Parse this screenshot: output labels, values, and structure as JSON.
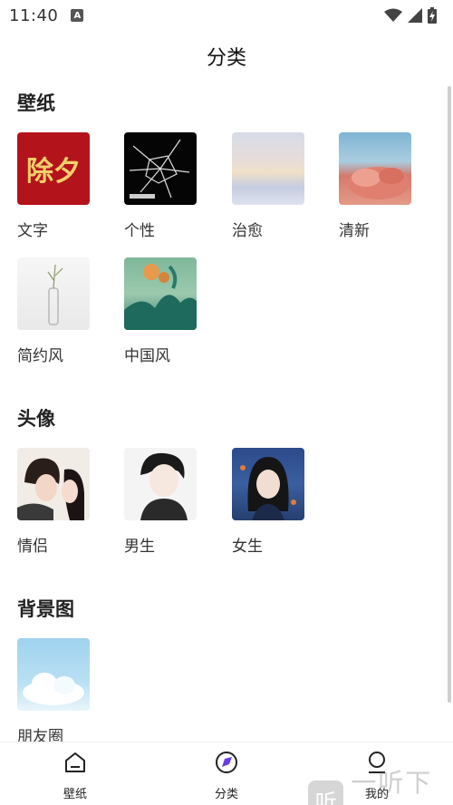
{
  "status": {
    "time": "11:40",
    "notif_badge": "A"
  },
  "page": {
    "title": "分类"
  },
  "sections": [
    {
      "title": "壁纸",
      "items": [
        {
          "label": "文字",
          "thumb_text": "除夕"
        },
        {
          "label": "个性"
        },
        {
          "label": "治愈"
        },
        {
          "label": "清新"
        },
        {
          "label": "简约风"
        },
        {
          "label": "中国风"
        }
      ]
    },
    {
      "title": "头像",
      "items": [
        {
          "label": "情侣"
        },
        {
          "label": "男生"
        },
        {
          "label": "女生"
        }
      ]
    },
    {
      "title": "背景图",
      "items": [
        {
          "label": "朋友圈"
        }
      ]
    }
  ],
  "nav": {
    "items": [
      {
        "label": "壁纸",
        "icon": "home-icon"
      },
      {
        "label": "分类",
        "icon": "category-icon",
        "active": true
      },
      {
        "label": "我的",
        "icon": "profile-icon"
      }
    ]
  },
  "watermark": {
    "logo": "听",
    "text": "一听下载"
  }
}
